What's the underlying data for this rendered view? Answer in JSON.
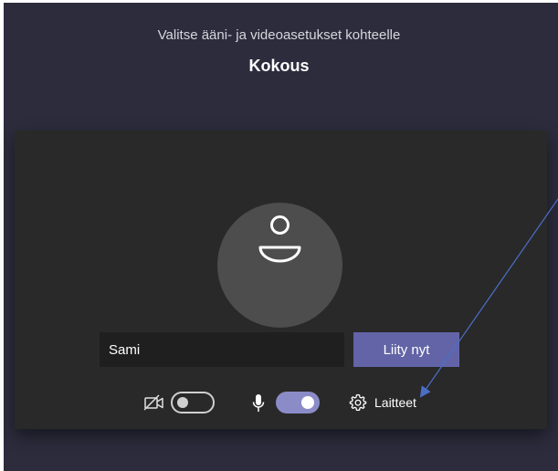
{
  "header": {
    "subtitle": "Valitse ääni- ja videoasetukset kohteelle",
    "title": "Kokous"
  },
  "join": {
    "name_value": "Sami",
    "join_label": "Liity nyt"
  },
  "controls": {
    "camera_on": false,
    "mic_on": true,
    "devices_label": "Laitteet"
  },
  "icons": {
    "avatar": "person-icon",
    "camera": "camera-off-icon",
    "mic": "microphone-icon",
    "devices": "gear-icon"
  },
  "colors": {
    "background": "#2c2c3d",
    "panel": "#292929",
    "accent": "#6264a7",
    "toggle_on": "#8b8cc7",
    "annotation_arrow": "#4a6fc9"
  }
}
